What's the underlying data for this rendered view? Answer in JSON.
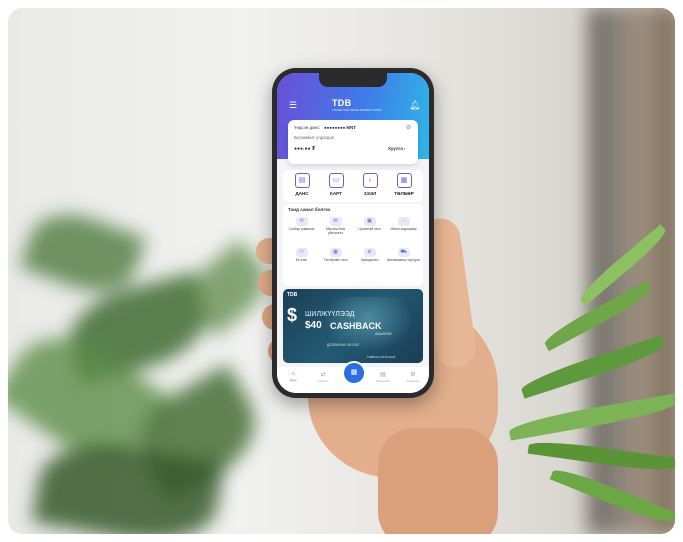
{
  "app": {
    "logo": "TDB",
    "logo_sub": "TRADE AND DEVELOPMENT BANK",
    "colors": {
      "accent": "#6b4fd8",
      "accent2": "#2fb6e8",
      "nav_active": "#2d6fe0"
    }
  },
  "header": {
    "menu_icon": "menu-icon",
    "bell_icon": "bell-icon"
  },
  "account": {
    "balance_label": "Үндсэн данс:",
    "balance_value": "●●●●●●●● MNT",
    "available_label": "Боломжит үлдэгдэл",
    "available_value": "●●●.●● ₮",
    "transfer": "Хуулга ›"
  },
  "menu": [
    {
      "label": "ДАНС",
      "icon": "account-icon",
      "glyph": "▤"
    },
    {
      "label": "КАРТ",
      "icon": "card-icon",
      "glyph": "▭"
    },
    {
      "label": "ЗЭЭЛ",
      "icon": "loan-icon",
      "glyph": "♁"
    },
    {
      "label": "ТӨЛБӨР",
      "icon": "payment-icon",
      "glyph": "▦"
    }
  ],
  "suggest": {
    "title": "Танд санал болгох",
    "items": [
      {
        "label": "Солбар хуваалах",
        "icon": "exchange-icon",
        "glyph": "⟲"
      },
      {
        "label": "Мессеж банк үйлчилгээ",
        "icon": "message-icon",
        "glyph": "✉"
      },
      {
        "label": "Цалинтай зээл",
        "icon": "salary-loan-icon",
        "glyph": "▣"
      },
      {
        "label": "Мөнгө хадгаламж",
        "icon": "savings-icon",
        "glyph": "◌"
      },
      {
        "label": "Eb зээл",
        "icon": "eb-loan-icon",
        "glyph": "⚇"
      },
      {
        "label": "Тэтгэврийн зээл",
        "icon": "pension-icon",
        "glyph": "▦"
      },
      {
        "label": "Хувьцаалал",
        "icon": "shares-icon",
        "glyph": "⊘"
      },
      {
        "label": "Автомашины торгууль",
        "icon": "car-icon",
        "glyph": "⛟"
      }
    ]
  },
  "banner": {
    "logo": "TDB",
    "line1": "ШИЛЖҮҮЛЭЭД",
    "amount": "$40",
    "cashback": "CASHBACK",
    "sub": "АВААРАЙ",
    "small": "ДОЛЛАРЫН 100 ХЭЛ",
    "footer": "TDBKAH POTA 2022"
  },
  "nav": [
    {
      "label": "Нүүр",
      "icon": "home-icon",
      "glyph": "⌂"
    },
    {
      "label": "Гүйлгээ",
      "icon": "transfer-icon",
      "glyph": "⇄"
    },
    {
      "label": "QR",
      "icon": "qr-icon",
      "glyph": "▦"
    },
    {
      "label": "Мэдээлэл",
      "icon": "news-icon",
      "glyph": "▤"
    },
    {
      "label": "Тохиргоо",
      "icon": "settings-icon",
      "glyph": "⚙"
    }
  ]
}
